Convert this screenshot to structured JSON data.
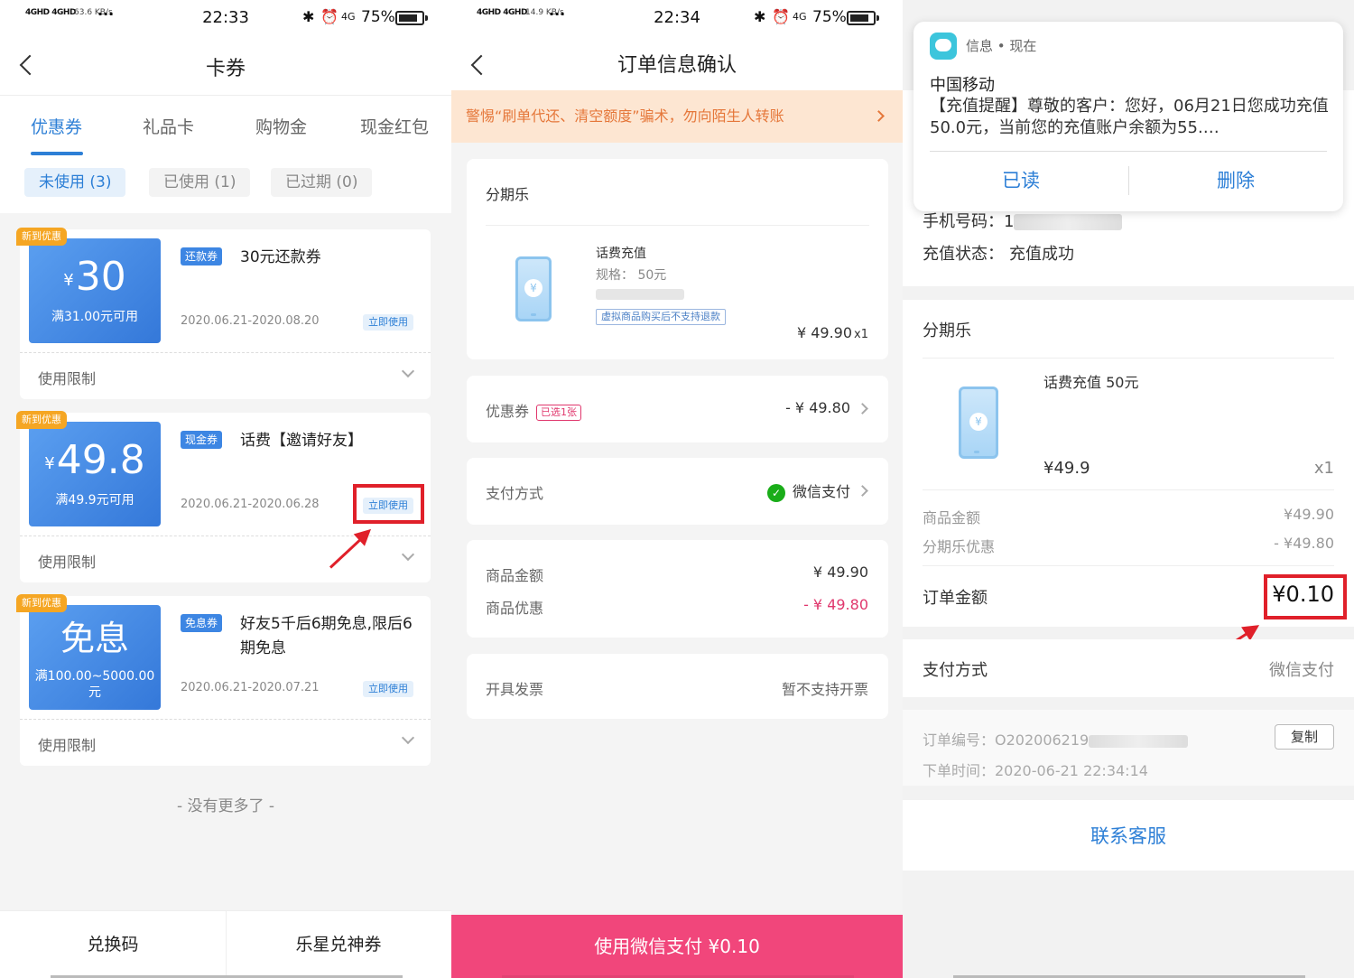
{
  "panel1": {
    "status": {
      "signal": "4GHD 4GHD",
      "speed": "63.6 KB/s",
      "dots": "···",
      "time": "22:33",
      "battery": "75%"
    },
    "title": "卡券",
    "tabs": [
      "优惠券",
      "礼品卡",
      "购物金",
      "现金红包"
    ],
    "filters": [
      "未使用 (3)",
      "已使用 (1)",
      "已过期 (0)"
    ],
    "coupons": [
      {
        "badge": "新到优惠",
        "currency": "¥",
        "amount": "30",
        "condition": "满31.00元可用",
        "type": "还款券",
        "name": "30元还款券",
        "date": "2020.06.21-2020.08.20",
        "use": "立即使用",
        "limit": "使用限制"
      },
      {
        "badge": "新到优惠",
        "currency": "¥",
        "amount": "49.8",
        "condition": "满49.9元可用",
        "type": "现金券",
        "name": "话费【邀请好友】",
        "date": "2020.06.21-2020.06.28",
        "use": "立即使用",
        "limit": "使用限制"
      },
      {
        "badge": "新到优惠",
        "amount": "免息",
        "condition": "满100.00~5000.00元",
        "type": "免息券",
        "name": "好友5千后6期免息,限后6期免息",
        "date": "2020.06.21-2020.07.21",
        "use": "立即使用",
        "limit": "使用限制"
      }
    ],
    "no_more": "- 没有更多了 -",
    "bottom": [
      "兑换码",
      "乐星兑神券"
    ]
  },
  "panel2": {
    "status": {
      "signal": "4GHD 4GHD",
      "speed": "14.9 KB/s",
      "dots": "···",
      "time": "22:34",
      "battery": "75%"
    },
    "title": "订单信息确认",
    "warning": "警惕“刷单代还、清空额度”骗术，勿向陌生人转账",
    "store": "分期乐",
    "product": {
      "name": "话费充值",
      "spec": "规格： 50元",
      "note": "虚拟商品购买后不支持退款",
      "price": "¥ 49.90",
      "qty": "x1"
    },
    "coupon": {
      "label": "优惠券",
      "tag": "已选1张",
      "value": "- ¥ 49.80"
    },
    "payment": {
      "label": "支付方式",
      "value": "微信支付"
    },
    "amount": {
      "label": "商品金额",
      "value": "¥ 49.90"
    },
    "discount": {
      "label": "商品优惠",
      "value": "- ¥ 49.80"
    },
    "invoice": {
      "label": "开具发票",
      "value": "暂不支持开票"
    },
    "pay_button": "使用微信支付 ¥0.10"
  },
  "panel3": {
    "notification": {
      "source": "信息 • 现在",
      "title": "中国移动",
      "body": "【充值提醒】尊敬的客户：您好，06月21日您成功充值50.0元，当前您的充值账户余额为55.…",
      "read": "已读",
      "delete": "删除"
    },
    "phone_label": "手机号码：",
    "phone_partial": "1",
    "status_label": "充值状态：",
    "status_value": "充值成功",
    "store": "分期乐",
    "product": {
      "name": "话费充值 50元",
      "price": "¥49.9",
      "qty": "x1"
    },
    "goods_amount": {
      "label": "商品金额",
      "value": "¥49.90"
    },
    "discount": {
      "label": "分期乐优惠",
      "value": "- ¥49.80"
    },
    "order_amount": {
      "label": "订单金额",
      "value": "¥0.10"
    },
    "payment": {
      "label": "支付方式",
      "value": "微信支付"
    },
    "order_no": "订单编号：O202006219",
    "order_time": "下单时间：2020-06-21 22:34:14",
    "copy": "复制",
    "service": "联系客服"
  },
  "colors": {
    "accent": "#2d7fd6",
    "pay": "#f1467b",
    "warn_bg": "#fde6d2",
    "highlight": "#e0202a"
  }
}
